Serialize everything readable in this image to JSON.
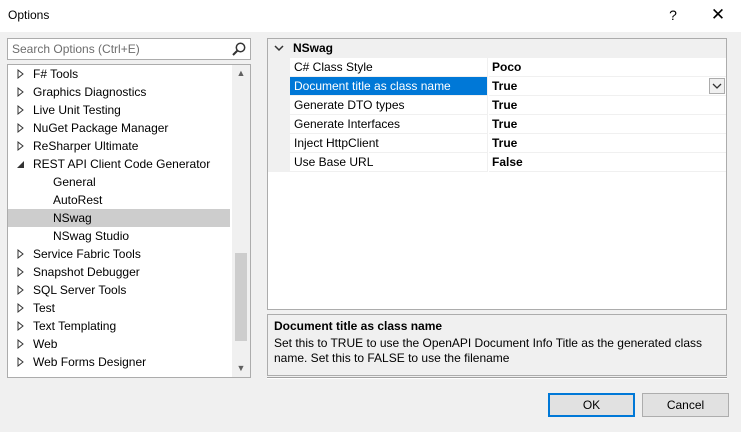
{
  "window": {
    "title": "Options",
    "help_glyph": "?",
    "close_glyph": "✕"
  },
  "search": {
    "placeholder": "Search Options (Ctrl+E)",
    "icon": "search-icon"
  },
  "tree": {
    "items": [
      {
        "label": "F# Tools",
        "state": "collapsed"
      },
      {
        "label": "Graphics Diagnostics",
        "state": "collapsed"
      },
      {
        "label": "Live Unit Testing",
        "state": "collapsed"
      },
      {
        "label": "NuGet Package Manager",
        "state": "collapsed"
      },
      {
        "label": "ReSharper Ultimate",
        "state": "collapsed"
      },
      {
        "label": "REST API Client Code Generator",
        "state": "expanded"
      },
      {
        "label": "General",
        "state": "leaf"
      },
      {
        "label": "AutoRest",
        "state": "leaf"
      },
      {
        "label": "NSwag",
        "state": "leaf",
        "selected": true
      },
      {
        "label": "NSwag Studio",
        "state": "leaf"
      },
      {
        "label": "Service Fabric Tools",
        "state": "collapsed"
      },
      {
        "label": "Snapshot Debugger",
        "state": "collapsed"
      },
      {
        "label": "SQL Server Tools",
        "state": "collapsed"
      },
      {
        "label": "Test",
        "state": "collapsed"
      },
      {
        "label": "Text Templating",
        "state": "collapsed"
      },
      {
        "label": "Web",
        "state": "collapsed"
      },
      {
        "label": "Web Forms Designer",
        "state": "collapsed"
      }
    ]
  },
  "property_grid": {
    "category": "NSwag",
    "rows": [
      {
        "name": "C# Class Style",
        "value": "Poco"
      },
      {
        "name": "Document title as class name",
        "value": "True",
        "selected": true
      },
      {
        "name": "Generate DTO types",
        "value": "True"
      },
      {
        "name": "Generate Interfaces",
        "value": "True"
      },
      {
        "name": "Inject HttpClient",
        "value": "True"
      },
      {
        "name": "Use Base URL",
        "value": "False"
      }
    ]
  },
  "description": {
    "title": "Document title as class name",
    "text": "Set this to TRUE to use the OpenAPI Document Info Title as the generated class name. Set this to FALSE to use the filename"
  },
  "buttons": {
    "ok": "OK",
    "cancel": "Cancel"
  },
  "colors": {
    "selection": "#0078d7",
    "tree_selection": "#cdcdcd",
    "background": "#f0f0f0"
  }
}
